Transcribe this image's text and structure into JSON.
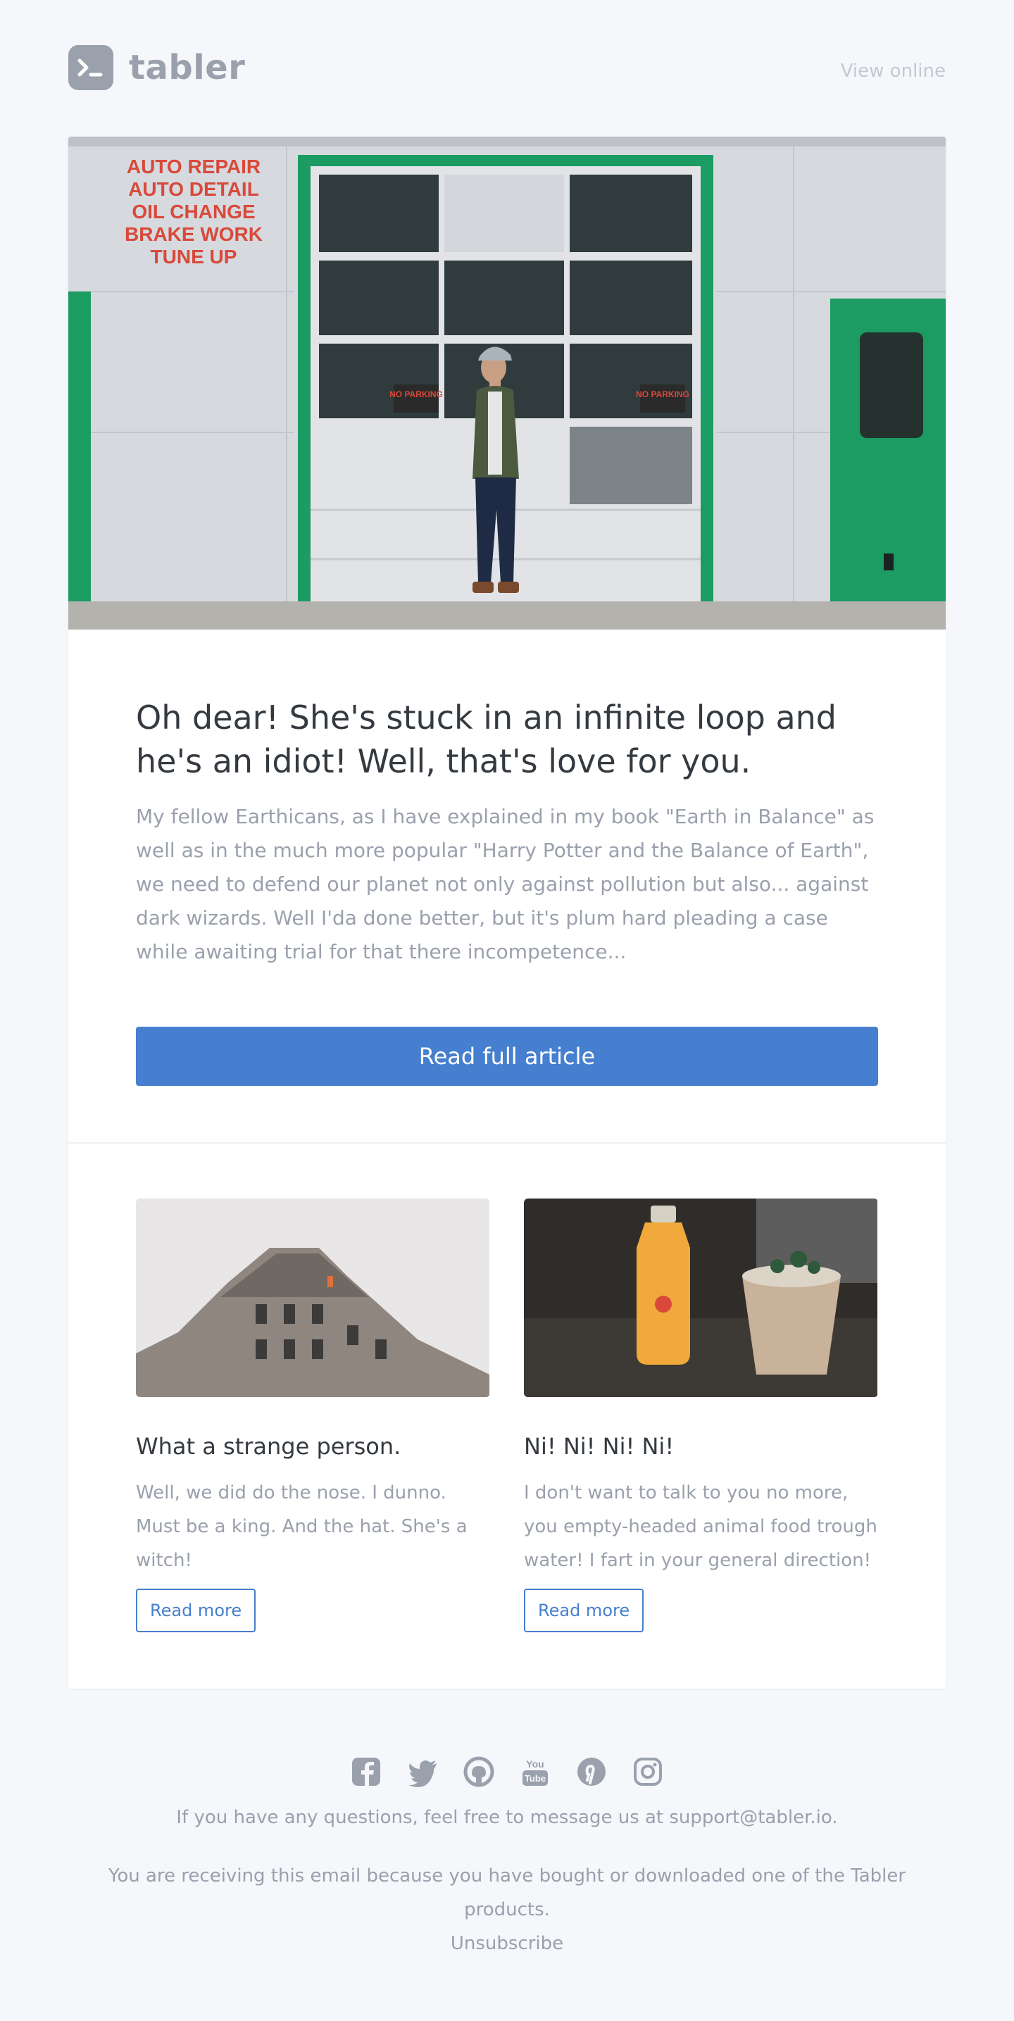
{
  "header": {
    "brand": "tabler",
    "view_online": "View online"
  },
  "hero": {
    "sign_lines": [
      "AUTO REPAIR",
      "AUTO DETAIL",
      "OIL CHANGE",
      "BRAKE WORK",
      "TUNE UP"
    ],
    "no_parking": "NO PARKING"
  },
  "article": {
    "title": "Oh dear! She's stuck in an infinite loop and he's an idiot! Well, that's love for you.",
    "body": "My fellow Earthicans, as I have explained in my book \"Earth in Balance\" as well as in the much more popular \"Harry Potter and the Balance of Earth\", we need to defend our planet not only against pollution but also... against dark wizards. Well I'da done better, but it's plum hard pleading a case while awaiting trial for that there incompetence...",
    "button": "Read full article"
  },
  "teasers": [
    {
      "title": "What a strange person.",
      "body": "Well, we did do the nose. I dunno. Must be a king. And the hat. She's a witch!",
      "button": "Read more"
    },
    {
      "title": "Ni! Ni! Ni! Ni!",
      "body": "I don't want to talk to you no more, you empty-headed animal food trough water! I fart in your general direction!",
      "button": "Read more"
    }
  ],
  "footer": {
    "social_icons": [
      "facebook-icon",
      "twitter-icon",
      "github-icon",
      "youtube-icon",
      "pinterest-icon",
      "instagram-icon"
    ],
    "questions": "If you have any questions, feel free to message us at support@tabler.io.",
    "note": "You are receiving this email because you have bought or downloaded one of the Tabler products.",
    "unsubscribe": "Unsubscribe"
  },
  "colors": {
    "background": "#f5f7fb",
    "primary": "#467fcf",
    "muted": "#9aa0ac",
    "heading": "#343a40",
    "garage_green": "#1c9b63",
    "sign_red": "#d9493a"
  }
}
